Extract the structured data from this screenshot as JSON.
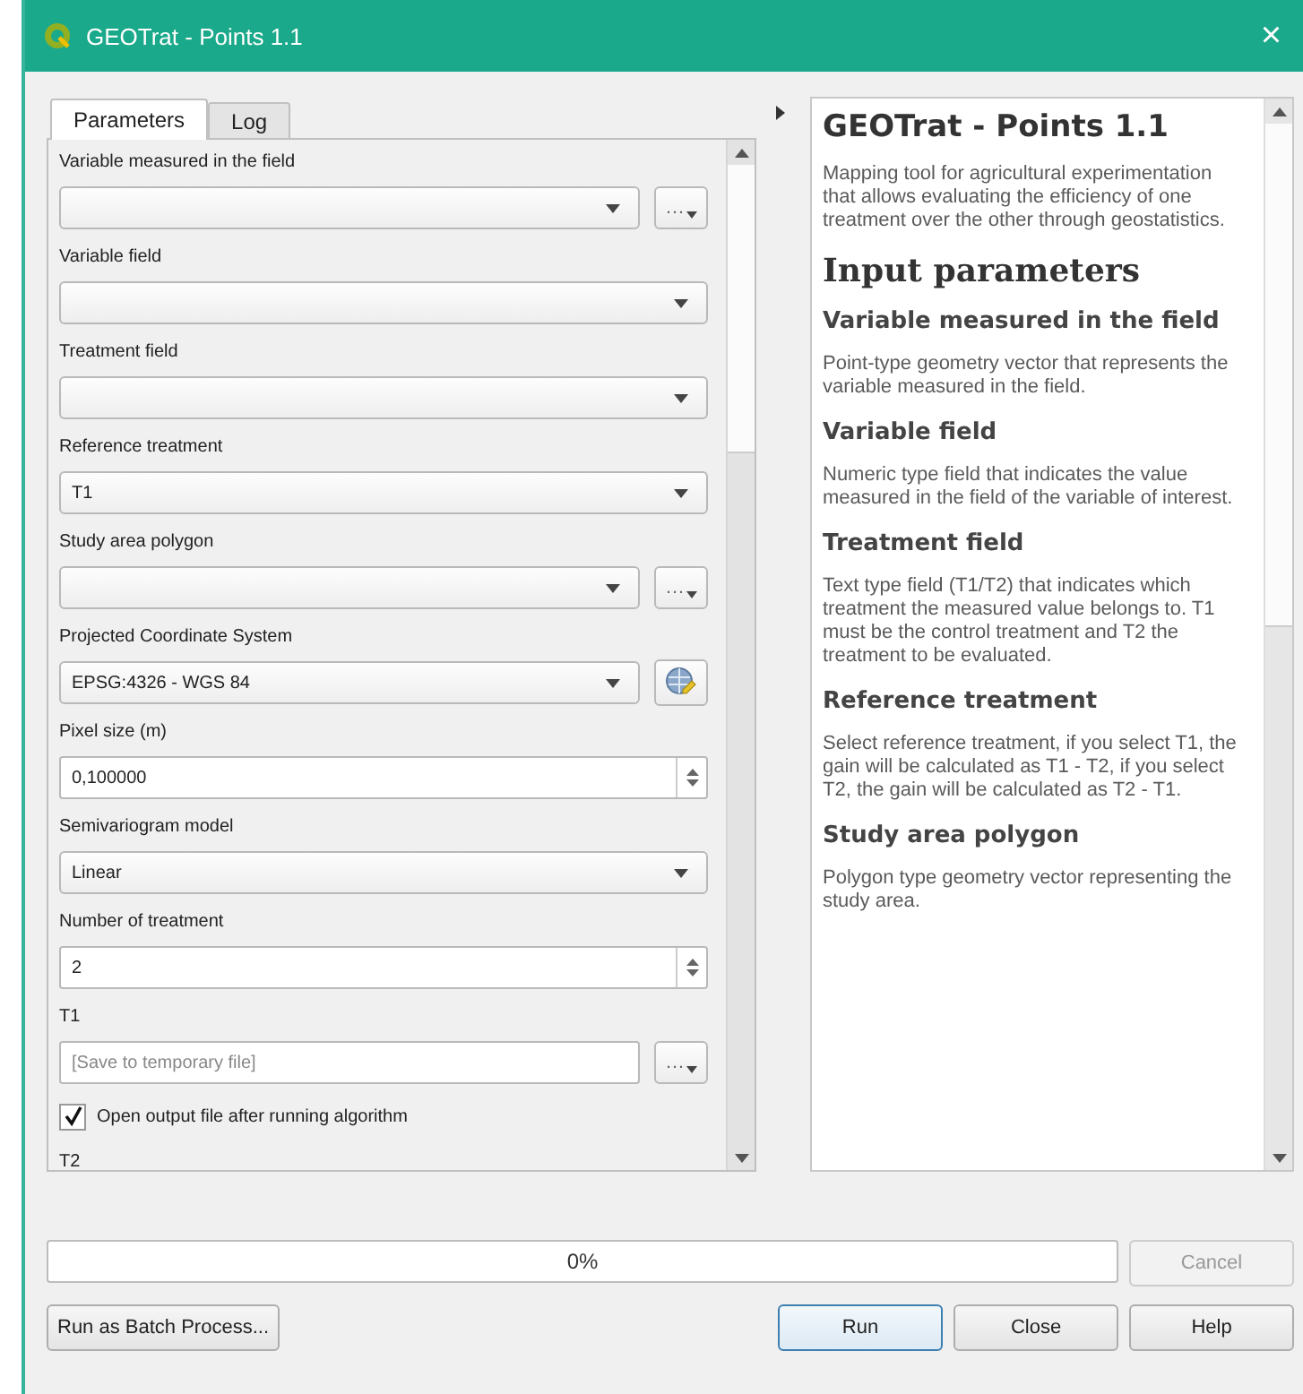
{
  "window": {
    "title": "GEOTrat - Points 1.1",
    "close": "×"
  },
  "tabs": [
    {
      "label": "Parameters",
      "selected": true
    },
    {
      "label": "Log",
      "selected": false
    }
  ],
  "parameters": [
    {
      "kind": "combo",
      "label": "Variable measured in the field",
      "browse": "…"
    },
    {
      "kind": "combo",
      "label": "Variable field"
    },
    {
      "kind": "combo",
      "label": "Treatment field"
    },
    {
      "kind": "combo",
      "label": "Reference treatment",
      "value": "T1"
    },
    {
      "kind": "combo",
      "label": "Study area polygon",
      "browse": "…"
    },
    {
      "kind": "crs",
      "label": "Projected Coordinate System",
      "value": "EPSG:4326 - WGS 84"
    },
    {
      "kind": "spin",
      "label": "Pixel size (m)",
      "value": "0,100000"
    },
    {
      "kind": "combo",
      "label": "Semivariogram model",
      "value": "Linear"
    },
    {
      "kind": "spin",
      "label": "Number of treatment",
      "value": "2"
    },
    {
      "kind": "output",
      "label": "T1",
      "placeholder": "[Save to temporary file]",
      "browse": "…"
    },
    {
      "kind": "checkbox",
      "label": "Open output file after running algorithm",
      "checked": true
    },
    {
      "kind": "heading",
      "label": "T2"
    }
  ],
  "help": {
    "title": "GEOTrat - Points 1.1",
    "intro": "Mapping tool for agricultural experimentation that allows evaluating the efficiency of one treatment over the other through geostatistics.",
    "section": "Input parameters",
    "items": [
      {
        "heading": "Variable measured in the field",
        "text": "Point-type geometry vector that represents the variable measured in the field."
      },
      {
        "heading": "Variable field",
        "text": "Numeric type field that indicates the value measured in the field of the variable of interest."
      },
      {
        "heading": "Treatment field",
        "text": "Text type field (T1/T2) that indicates which treatment the measured value belongs to. T1 must be the control treatment and T2 the treatment to be evaluated."
      },
      {
        "heading": "Reference treatment",
        "text": "Select reference treatment, if you select T1, the gain will be calculated as T1 - T2, if you select T2, the gain will be calculated as T2 - T1."
      },
      {
        "heading": "Study area polygon",
        "text": "Polygon type geometry vector representing the study area."
      }
    ]
  },
  "progress": {
    "text": "0%"
  },
  "cancel": {
    "label": "Cancel",
    "disabled": true
  },
  "buttons": [
    {
      "label": "Run as Batch Process...",
      "default": false
    },
    {
      "label": "Run",
      "default": true
    },
    {
      "label": "Close",
      "default": false
    },
    {
      "label": "Help",
      "default": false
    }
  ]
}
